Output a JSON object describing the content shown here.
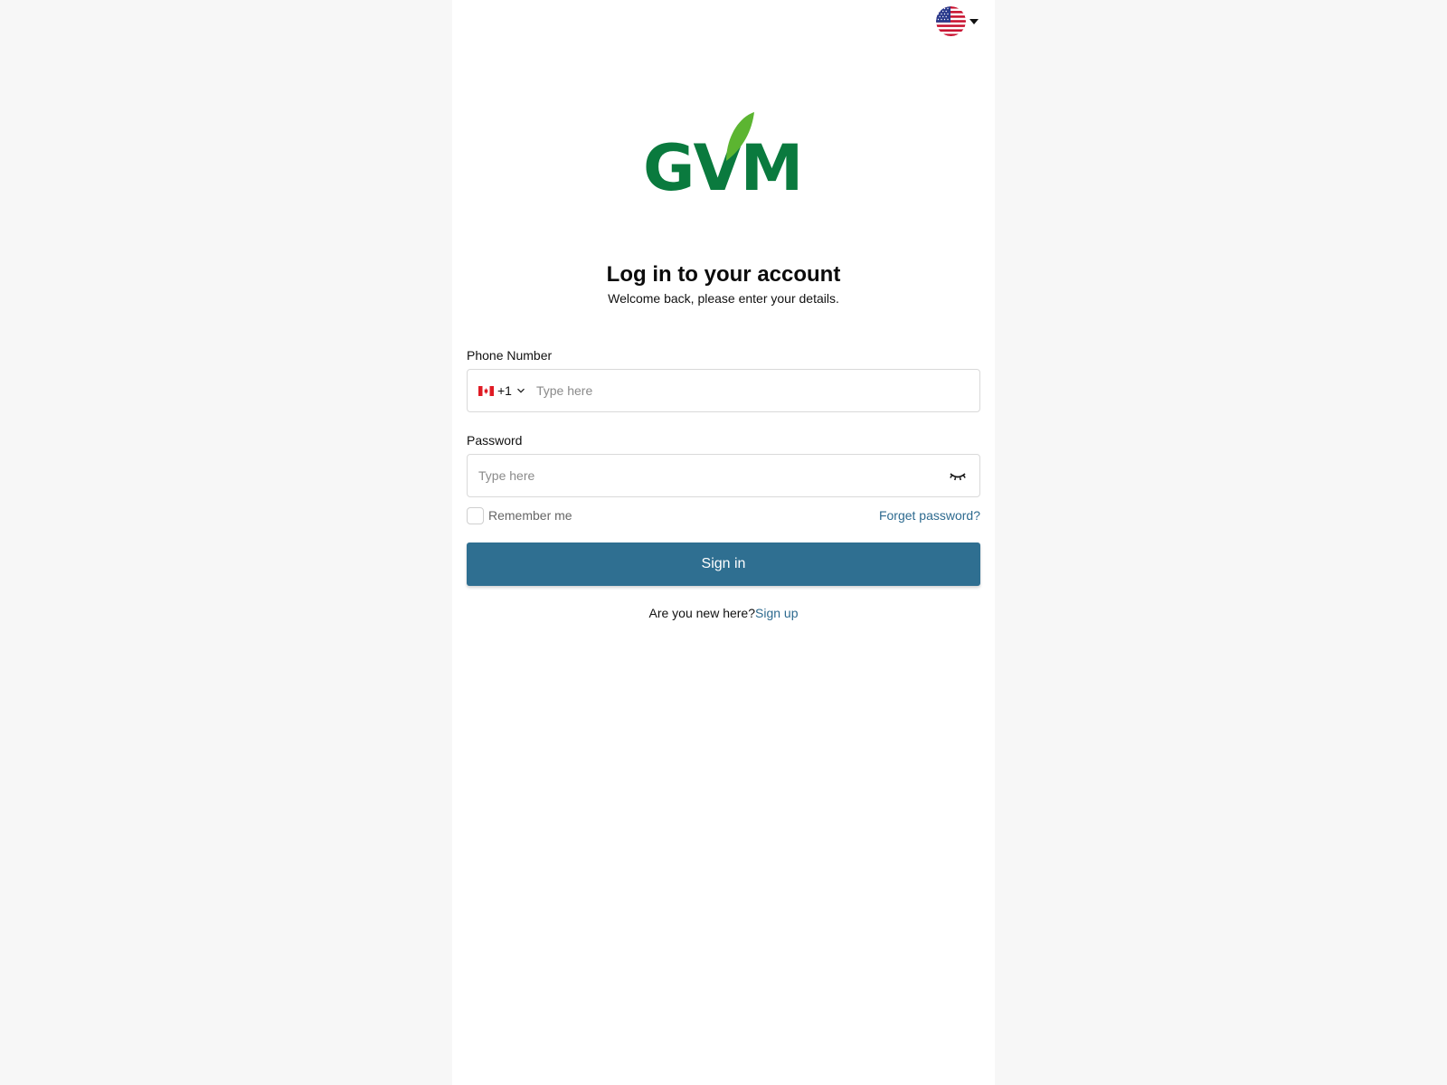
{
  "language_switcher": {
    "current_flag_icon": "us-flag-icon",
    "dropdown_icon": "caret-down-icon"
  },
  "brand": {
    "logo_text": "GVM",
    "logo_color": "#0a7a3e",
    "leaf_color": "#5cb531"
  },
  "heading": {
    "title": "Log in to your account",
    "subtitle": "Welcome back, please enter your details."
  },
  "phone": {
    "label": "Phone Number",
    "country_flag_icon": "canada-flag-icon",
    "country_code": "+1",
    "placeholder": "Type here",
    "value": ""
  },
  "password": {
    "label": "Password",
    "placeholder": "Type here",
    "value": "",
    "toggle_icon": "eye-closed-icon"
  },
  "options": {
    "remember_label": "Remember me",
    "remember_checked": false,
    "forgot_label": "Forget password?"
  },
  "actions": {
    "signin_label": "Sign in",
    "signin_color": "#2f6f91"
  },
  "signup": {
    "prompt": "Are you new here?",
    "link_label": "Sign up"
  }
}
